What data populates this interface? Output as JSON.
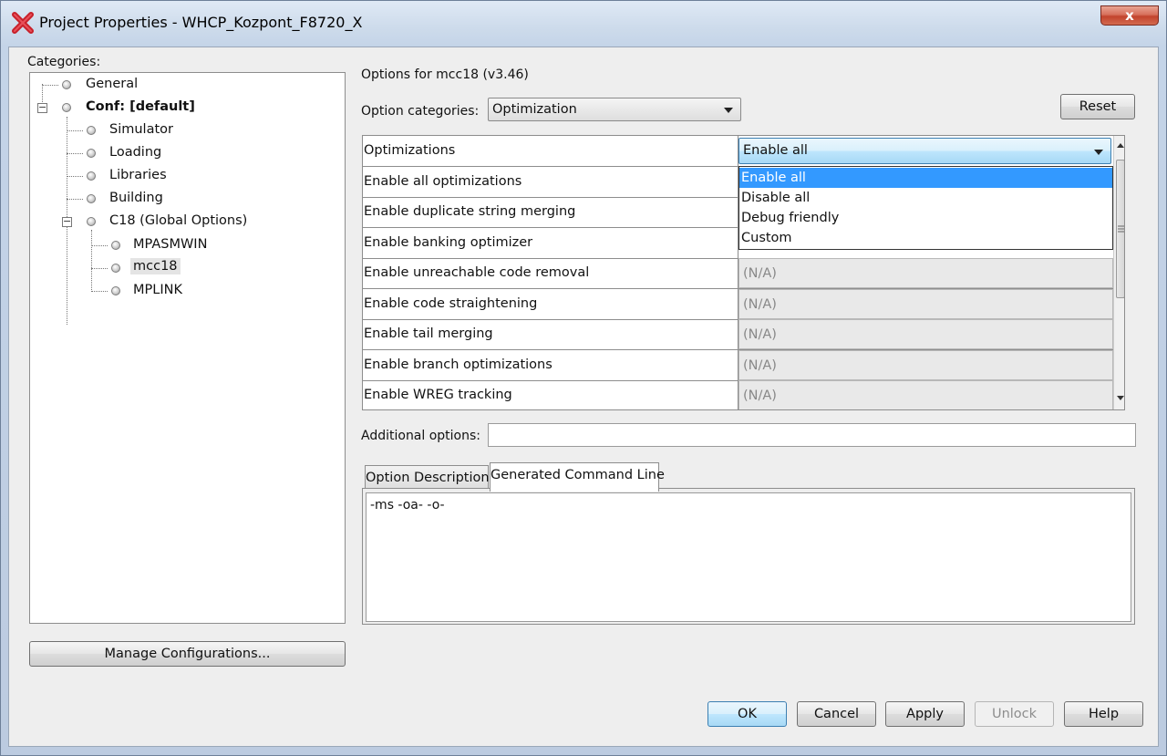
{
  "window": {
    "title": "Project Properties - WHCP_Kozpont_F8720_X",
    "close_label": "x"
  },
  "categories": {
    "label": "Categories:",
    "tree": [
      {
        "label": "General",
        "bold": false
      },
      {
        "label": "Conf: [default]",
        "bold": true,
        "expanded": true
      },
      {
        "label": "Simulator"
      },
      {
        "label": "Loading"
      },
      {
        "label": "Libraries"
      },
      {
        "label": "Building"
      },
      {
        "label": "C18 (Global Options)",
        "expanded": true
      },
      {
        "label": "MPASMWIN"
      },
      {
        "label": "mcc18",
        "selected": true
      },
      {
        "label": "MPLINK"
      }
    ],
    "expand_symbol": "−"
  },
  "manage_button": "Manage Configurations...",
  "options": {
    "header": "Options for mcc18 (v3.46)",
    "category_label": "Option categories:",
    "category_value": "Optimization",
    "reset_label": "Reset"
  },
  "grid": {
    "rows": [
      {
        "name": "Optimizations",
        "value": "Enable all"
      },
      {
        "name": "Enable all optimizations",
        "value": ""
      },
      {
        "name": "Enable duplicate string merging",
        "value": ""
      },
      {
        "name": "Enable banking optimizer",
        "value": ""
      },
      {
        "name": "Enable unreachable code removal",
        "value": "(N/A)"
      },
      {
        "name": "Enable code straightening",
        "value": "(N/A)"
      },
      {
        "name": "Enable tail merging",
        "value": "(N/A)"
      },
      {
        "name": "Enable branch optimizations",
        "value": "(N/A)"
      },
      {
        "name": "Enable WREG tracking",
        "value": "(N/A)"
      }
    ],
    "dropdown_options": [
      "Enable all",
      "Disable all",
      "Debug friendly",
      "Custom"
    ],
    "dropdown_selected": "Enable all"
  },
  "additional": {
    "label": "Additional options:",
    "value": ""
  },
  "tabs": {
    "items": [
      "Option Description",
      "Generated Command Line"
    ],
    "active": "Generated Command Line",
    "content": "-ms -oa- -o-"
  },
  "footer": {
    "ok": "OK",
    "cancel": "Cancel",
    "apply": "Apply",
    "unlock": "Unlock",
    "help": "Help"
  },
  "colors": {
    "selection": "#3399ff",
    "close": "#c2432d"
  }
}
